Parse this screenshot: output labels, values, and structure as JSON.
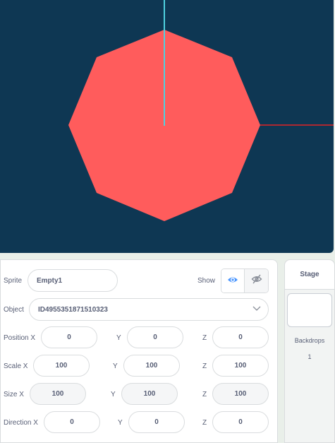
{
  "colors": {
    "stage_bg": "#0e3753",
    "octagon": "#ff5c5c",
    "y_axis": "#4fd1e0",
    "x_axis": "#e02424",
    "eye_active": "#4c97ff"
  },
  "sprite": {
    "label": "Sprite",
    "name": "Empty1",
    "show_label": "Show",
    "show_icon": "eye-icon",
    "hide_icon": "eye-slash-icon"
  },
  "object": {
    "label": "Object",
    "value": "ID4955351871510323",
    "dropdown_icon": "chevron-down-icon"
  },
  "position": {
    "label": "Position X",
    "x": "0",
    "y_label": "Y",
    "y": "0",
    "z_label": "Z",
    "z": "0"
  },
  "scale": {
    "label": "Scale X",
    "x": "100",
    "y_label": "Y",
    "y": "100",
    "z_label": "Z",
    "z": "100"
  },
  "size": {
    "label": "Size X",
    "x": "100",
    "y_label": "Y",
    "y": "100",
    "z_label": "Z",
    "z": "100"
  },
  "direction": {
    "label": "Direction X",
    "x": "0",
    "y_label": "Y",
    "y": "0",
    "z_label": "Z",
    "z": "0"
  },
  "stage_panel": {
    "title": "Stage",
    "backdrops_label": "Backdrops",
    "backdrops_count": "1"
  }
}
